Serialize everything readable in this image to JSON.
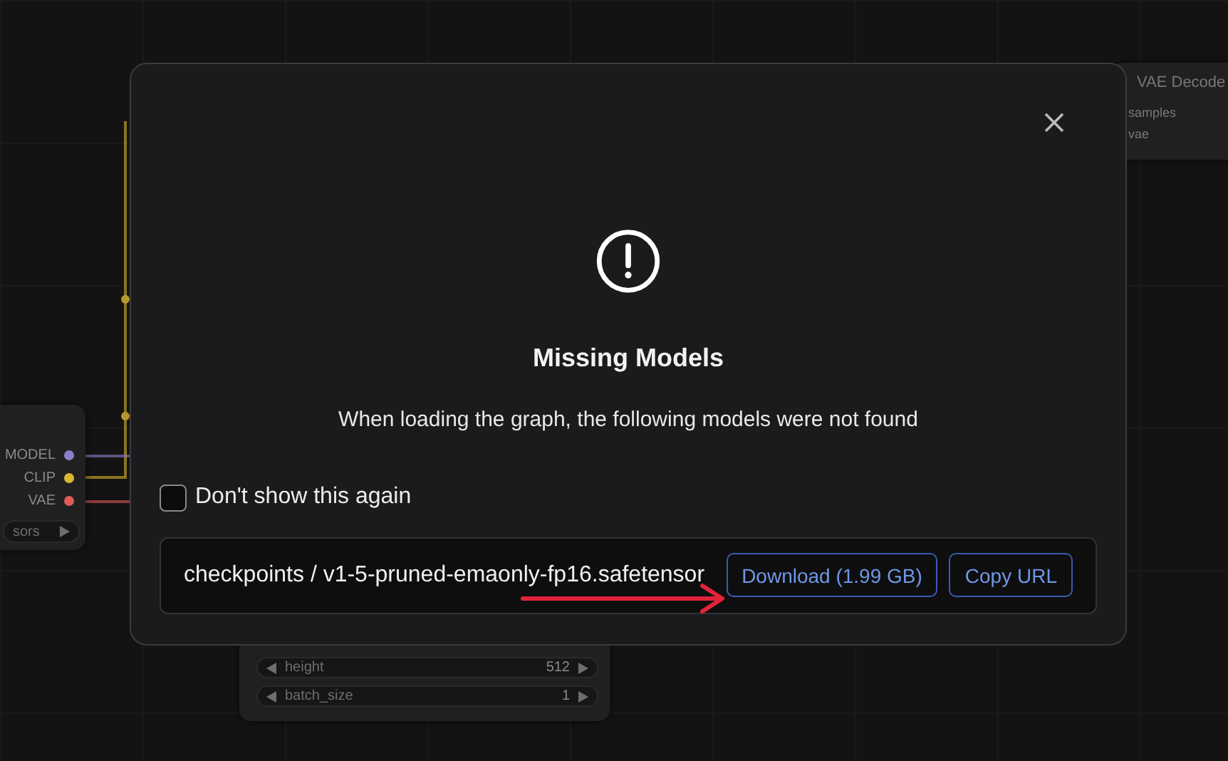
{
  "canvas": {
    "left_node": {
      "outputs": [
        {
          "label": "MODEL",
          "color": "#8a80c8"
        },
        {
          "label": "CLIP",
          "color": "#d8b830"
        },
        {
          "label": "VAE",
          "color": "#e05a5a"
        }
      ],
      "widget": {
        "label": "sors"
      }
    },
    "bottom_node": {
      "widgets": [
        {
          "label": "height",
          "value": "512"
        },
        {
          "label": "batch_size",
          "value": "1"
        }
      ]
    },
    "right_node": {
      "title": "VAE Decode",
      "inputs": [
        {
          "label": "samples"
        },
        {
          "label": "vae"
        }
      ]
    }
  },
  "dialog": {
    "title": "Missing Models",
    "message": "When loading the graph, the following models were not found",
    "dont_show_again": {
      "label": "Don't show this again",
      "checked": false
    },
    "models": [
      {
        "path": "checkpoints / v1-5-pruned-emaonly-fp16.safetensor",
        "download_label": "Download (1.99 GB)",
        "copy_label": "Copy URL"
      }
    ]
  }
}
